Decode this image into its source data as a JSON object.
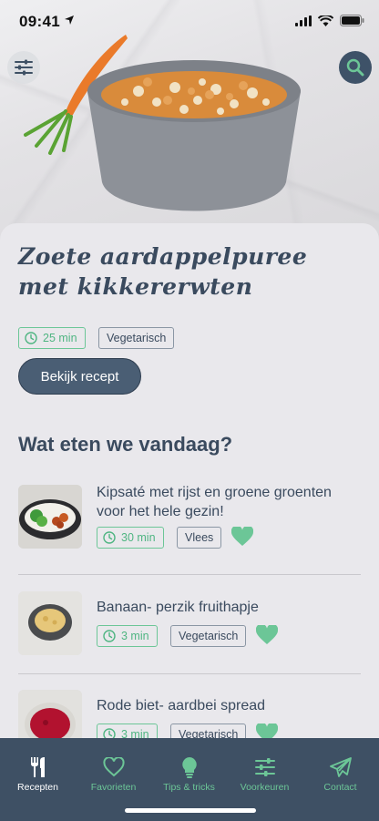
{
  "status_bar": {
    "time": "09:41"
  },
  "hero": {
    "title": "Zoete aardappelpuree met kikkererwten",
    "time_tag": "25 min",
    "category_tag": "Vegetarisch",
    "cta_label": "Bekijk recept"
  },
  "section": {
    "title": "Wat eten we vandaag?"
  },
  "recipes": [
    {
      "title": "Kipsaté met rijst en groene groenten voor het hele gezin!",
      "time": "30 min",
      "category": "Vlees",
      "favorite": true
    },
    {
      "title": "Banaan- perzik fruithapje",
      "time": "3 min",
      "category": "Vegetarisch",
      "favorite": true
    },
    {
      "title": "Rode biet- aardbei spread",
      "time": "3 min",
      "category": "Vegetarisch",
      "favorite": true
    }
  ],
  "tabbar": {
    "items": [
      {
        "label": "Recepten",
        "icon": "fork-knife-icon",
        "active": true
      },
      {
        "label": "Favorieten",
        "icon": "heart-icon",
        "active": false
      },
      {
        "label": "Tips & tricks",
        "icon": "lightbulb-icon",
        "active": false
      },
      {
        "label": "Voorkeuren",
        "icon": "sliders-icon",
        "active": false
      },
      {
        "label": "Contact",
        "icon": "paper-plane-icon",
        "active": false
      }
    ]
  },
  "colors": {
    "primary": "#3e5064",
    "accent": "#6cc697",
    "background": "#e9e8ec"
  }
}
